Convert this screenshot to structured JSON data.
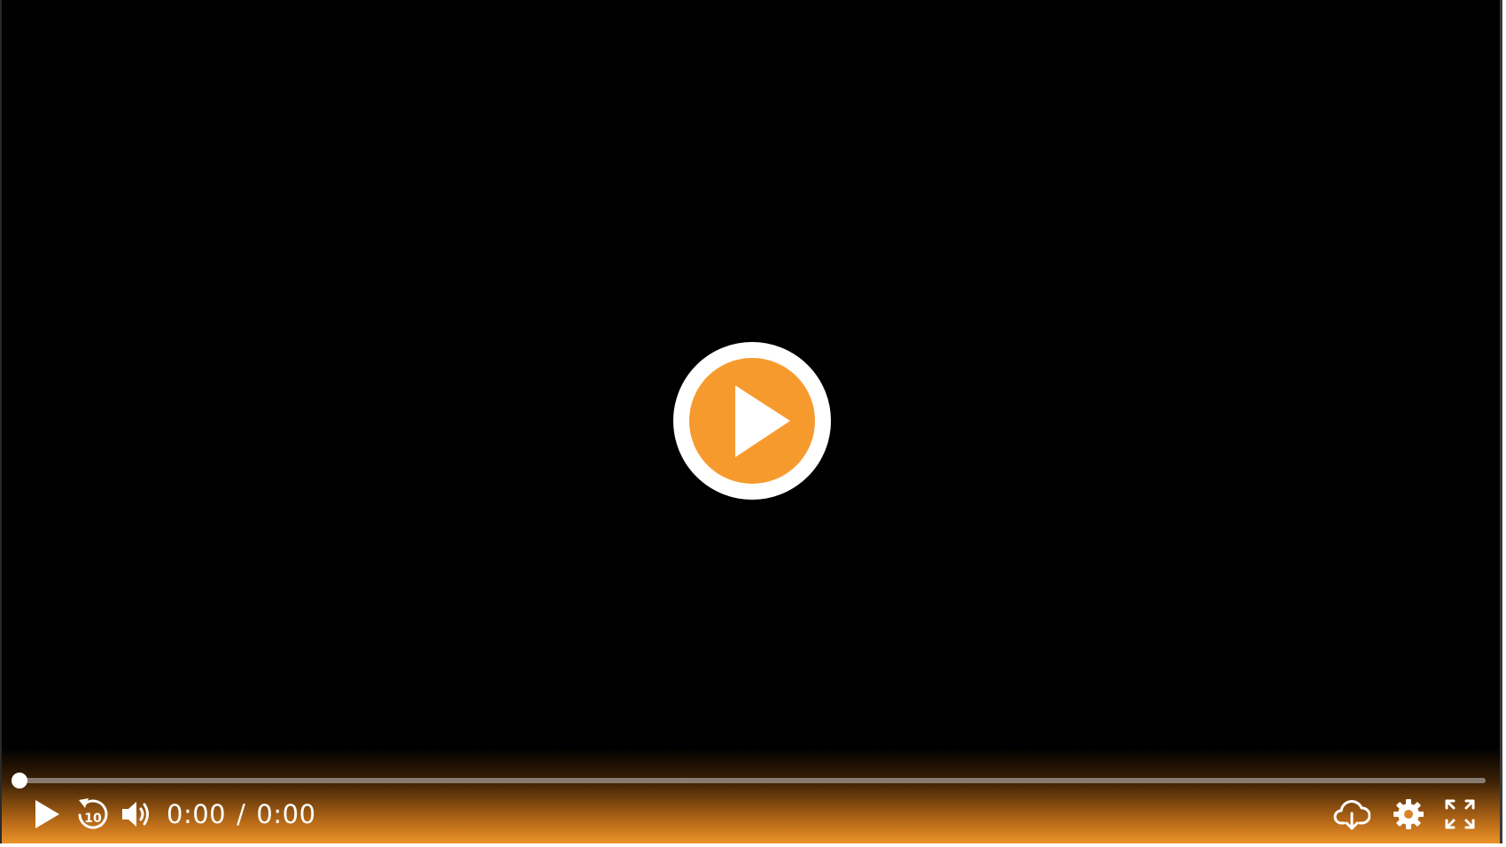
{
  "player": {
    "current_time": "0:00",
    "time_separator": "/",
    "duration": "0:00",
    "progress_fraction": 0,
    "accent_color": "#f79a2e",
    "background_color": "#000000"
  },
  "icons": {
    "big_play": "play-circle-icon",
    "play": "play-icon",
    "rewind": "rewind-10-icon",
    "volume": "volume-icon",
    "download": "cloud-download-icon",
    "settings": "gear-icon",
    "fullscreen": "fullscreen-icon"
  },
  "rewind_seconds": "10"
}
